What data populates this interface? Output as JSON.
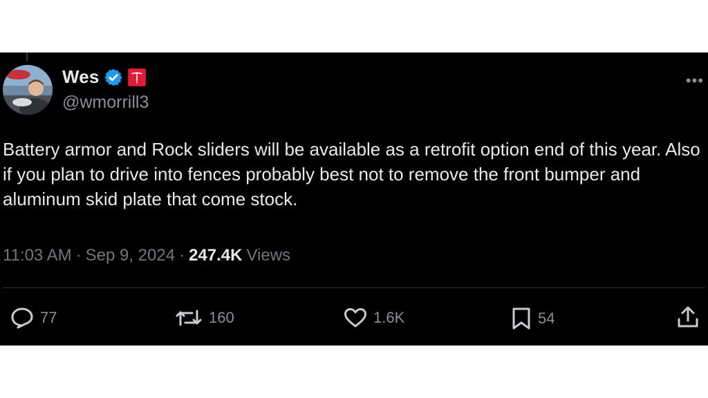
{
  "author": {
    "display_name": "Wes",
    "handle": "@wmorrill3",
    "verified": true,
    "affiliate_badge": "tesla-logo"
  },
  "tweet": {
    "text": "Battery armor and Rock sliders will be available as a retrofit option end of this year. Also if you plan to drive into fences probably best not to remove the front bumper and aluminum skid plate that come stock.",
    "time": "11:03 AM",
    "date": "Sep 9, 2024",
    "separator": "·",
    "views_count": "247.4K",
    "views_label": "Views"
  },
  "actions": {
    "replies": "77",
    "reposts": "160",
    "likes": "1.6K",
    "bookmarks": "54"
  },
  "colors": {
    "background": "#000000",
    "text_primary": "#e7e9ea",
    "text_secondary": "#71767b",
    "verified_blue": "#1d9bf0",
    "badge_red": "#e31937"
  }
}
